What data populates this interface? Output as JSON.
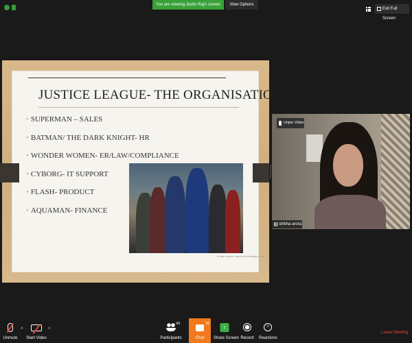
{
  "top_bar": {
    "viewing_banner": "You are viewing Justin Raj's screen",
    "view_options": "View Options",
    "exit_fullscreen": "Exit Full Screen",
    "banner_color": "#38a238"
  },
  "slide": {
    "title": "JUSTICE LEAGUE- THE ORGANISATION",
    "bullets": [
      "SUPERMAN – SALES",
      "BATMAN/ THE DARK KNIGHT- HR",
      "WONDER WOMEN- ER/LAW/COMPLIANCE",
      "CYBORG- IT SUPPORT",
      "FLASH- PRODUCT",
      "AQUAMAN- FINANCE"
    ],
    "image_caption": "Image source: www.justiceleague.com"
  },
  "participant": {
    "unpin_label": "Unpin Video",
    "name": "shikha arora"
  },
  "toolbar": {
    "unmute": "Unmute",
    "start_video": "Start Video",
    "participants": "Participants",
    "participants_count": "43",
    "chat": "Chat",
    "chat_count": "28",
    "share_screen": "Share Screen",
    "record": "Record",
    "reactions": "Reactions",
    "leave_meeting": "Leave Meeting",
    "caret": "^",
    "chat_color": "#f07a1d",
    "leave_color": "#e0443b"
  }
}
